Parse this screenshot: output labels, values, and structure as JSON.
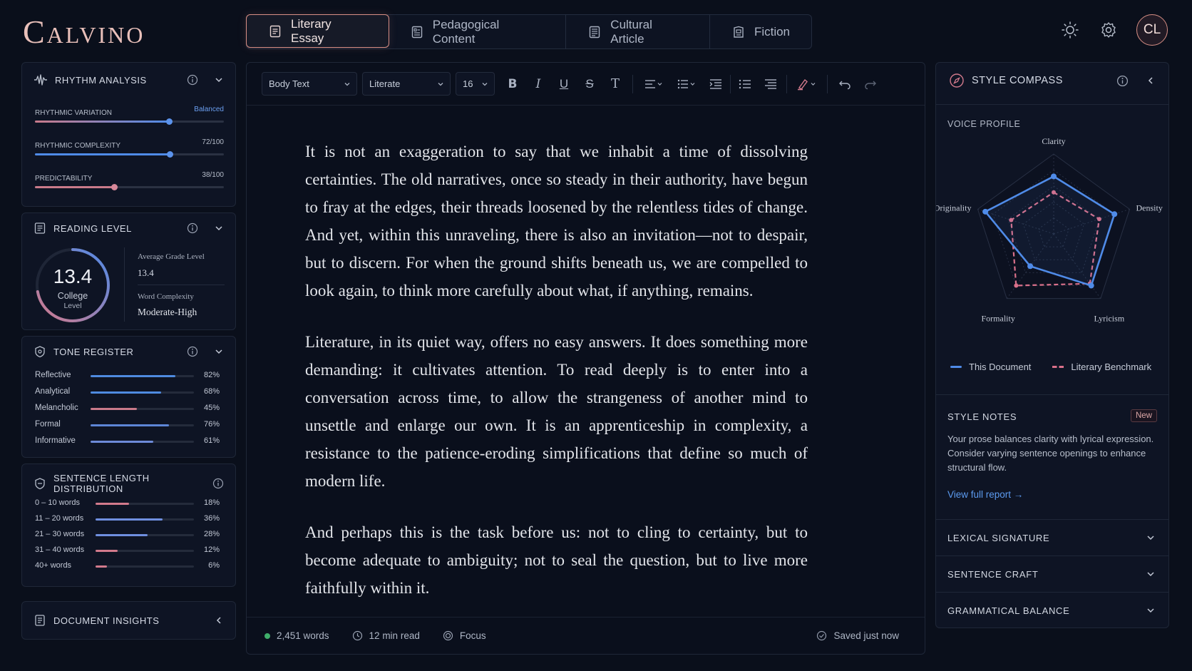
{
  "app": {
    "logo": "Calvino",
    "avatar": "CL"
  },
  "tabs": [
    {
      "label": "Literary Essay",
      "icon": "document-icon",
      "active": true
    },
    {
      "label": "Pedagogical Content",
      "icon": "lesson-icon",
      "active": false
    },
    {
      "label": "Cultural Article",
      "icon": "article-icon",
      "active": false
    },
    {
      "label": "Fiction",
      "icon": "book-icon",
      "active": false
    }
  ],
  "rhythm": {
    "title": "RHYTHM ANALYSIS",
    "variation": {
      "label": "RHYTHMIC VARIATION",
      "value": "Balanced",
      "level": 0.71
    },
    "complexity": {
      "label": "RHYTHMIC COMPLEXITY",
      "value": "72/100",
      "level": 0.72
    },
    "predictability": {
      "label": "PREDICTABILITY",
      "value": "38/100",
      "level": 0.42
    }
  },
  "reading": {
    "title": "READING LEVEL",
    "score": "13.4",
    "score_label": "College",
    "score_label2": "Level",
    "avg_grade_label": "Average Grade Level",
    "avg_grade_value": "13.4",
    "word_complexity_label": "Word Complexity",
    "word_complexity_value": "Moderate-High",
    "ring_fraction": 0.72
  },
  "tone": {
    "title": "TONE REGISTER",
    "items": [
      {
        "label": "Reflective",
        "value": "82%",
        "pct": 82,
        "color": "#4f8be0"
      },
      {
        "label": "Analytical",
        "value": "68%",
        "pct": 68,
        "color": "#4f8be0"
      },
      {
        "label": "Melancholic",
        "value": "45%",
        "pct": 45,
        "color": "#c97a8a"
      },
      {
        "label": "Formal",
        "value": "76%",
        "pct": 76,
        "color": "#5d86d6"
      },
      {
        "label": "Informative",
        "value": "61%",
        "pct": 61,
        "color": "#6d8ad8"
      }
    ]
  },
  "sentences": {
    "title": "SENTENCE LENGTH DISTRIBUTION",
    "items": [
      {
        "label": "0 – 10 words",
        "value": "18%",
        "pct": 18,
        "color": "#d27a8c"
      },
      {
        "label": "11 – 20 words",
        "value": "36%",
        "pct": 36,
        "color": "#6f8fe0"
      },
      {
        "label": "21 – 30 words",
        "value": "28%",
        "pct": 28,
        "color": "#6f8fe0"
      },
      {
        "label": "31 – 40 words",
        "value": "12%",
        "pct": 12,
        "color": "#d27a8c"
      },
      {
        "label": "40+ words",
        "value": "6%",
        "pct": 6,
        "color": "#d27a8c"
      }
    ]
  },
  "insights": {
    "title": "DOCUMENT INSIGHTS"
  },
  "toolbar": {
    "style": "Body Text",
    "font": "Literate",
    "size": "16"
  },
  "document": {
    "paragraphs": [
      "It is not an exaggeration to say that we inhabit a time of dissolving certainties. The old narratives, once so steady in their authority, have begun to fray at the edges, their threads loosened by the relentless tides of change. And yet, within this unraveling, there is also an invitation—not to despair, but to discern. For when the ground shifts beneath us, we are compelled to look again, to think more carefully about what, if anything, remains.",
      "Literature, in its quiet way, offers no easy answers. It does something more demanding: it cultivates attention. To read deeply is to enter into a conversation across time, to allow the strangeness of another mind to unsettle and enlarge our own. It is an apprenticeship in complexity, a resistance to the patience-eroding simplifications that define so much of modern life.",
      "And perhaps this is the task before us: not to cling to certainty, but to become adequate to ambiguity; not to seal the question, but to live more faithfully within it."
    ]
  },
  "status": {
    "words": "2,451 words",
    "read_time": "12 min read",
    "focus": "Focus",
    "saved": "Saved just now"
  },
  "compass": {
    "title": "STYLE COMPASS",
    "voice_profile": "VOICE PROFILE",
    "axes": [
      "Clarity",
      "Density",
      "Lyricism",
      "Formality",
      "Originality"
    ],
    "this_document": [
      0.72,
      0.8,
      0.8,
      0.5,
      0.9
    ],
    "benchmark": [
      0.52,
      0.6,
      0.77,
      0.8,
      0.56
    ],
    "legend_doc": "This Document",
    "legend_bench": "Literary Benchmark",
    "doc_color": "#4f8be8",
    "bench_color": "#d9708a"
  },
  "style_notes": {
    "title": "STYLE NOTES",
    "badge": "New",
    "text": "Your prose balances clarity with lyrical expression. Consider varying sentence openings to enhance structural flow.",
    "link": "View full report →"
  },
  "sections": [
    "LEXICAL SIGNATURE",
    "SENTENCE CRAFT",
    "GRAMMATICAL BALANCE"
  ]
}
